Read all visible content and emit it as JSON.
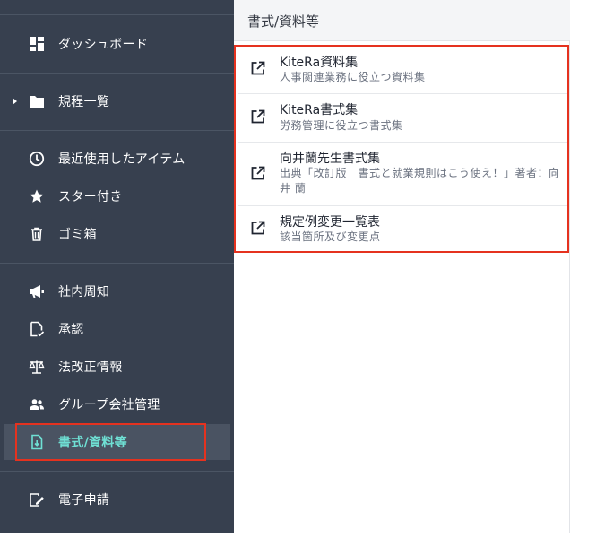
{
  "sidebar": {
    "items": [
      {
        "label": "ダッシュボード",
        "icon": "dashboard-icon"
      },
      {
        "label": "規程一覧",
        "icon": "folder-icon"
      },
      {
        "label": "最近使用したアイテム",
        "icon": "clock-icon"
      },
      {
        "label": "スター付き",
        "icon": "star-icon"
      },
      {
        "label": "ゴミ箱",
        "icon": "trash-icon"
      },
      {
        "label": "社内周知",
        "icon": "megaphone-icon"
      },
      {
        "label": "承認",
        "icon": "approval-document-icon"
      },
      {
        "label": "法改正情報",
        "icon": "scale-icon"
      },
      {
        "label": "グループ会社管理",
        "icon": "group-icon"
      },
      {
        "label": "書式/資料等",
        "icon": "document-download-icon"
      },
      {
        "label": "電子申請",
        "icon": "signature-icon"
      }
    ],
    "active_color": "#6fe0d4"
  },
  "panel": {
    "title": "書式/資料等",
    "items": [
      {
        "title": "KiteRa資料集",
        "subtitle": "人事関連業務に役立つ資料集"
      },
      {
        "title": "KiteRa書式集",
        "subtitle": "労務管理に役立つ書式集"
      },
      {
        "title": "向井蘭先生書式集",
        "subtitle": "出典「改訂版　書式と就業規則はこう使え！」著者：向井 蘭"
      },
      {
        "title": "規定例変更一覧表",
        "subtitle": "該当箇所及び変更点"
      }
    ]
  },
  "colors": {
    "sidebar_bg": "#37404f",
    "highlight_red": "#e5321f"
  }
}
